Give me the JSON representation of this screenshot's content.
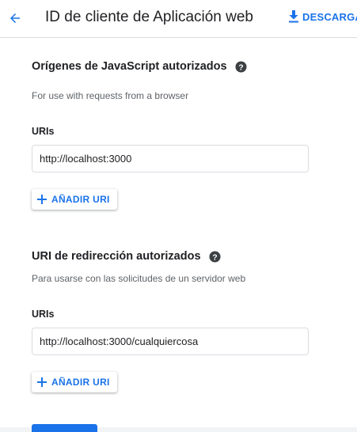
{
  "header": {
    "title": "ID de cliente de Aplicación web",
    "download_label": "DESCARGAR"
  },
  "js_origins": {
    "title": "Orígenes de JavaScript autorizados",
    "description": "For use with requests from a browser",
    "field_label": "URIs",
    "uri_value": "http://localhost:3000",
    "add_label": "AÑADIR URI"
  },
  "redirect_uris": {
    "title": "URI de redirección autorizados",
    "description": "Para usarse con las solicitudes de un servidor web",
    "field_label": "URIs",
    "uri_value": "http://localhost:3000/cualquiercosa",
    "add_label": "AÑADIR URI"
  },
  "icons": {
    "back": "arrow-back-icon",
    "download": "download-icon",
    "help": "help-icon",
    "add": "plus-icon"
  },
  "colors": {
    "accent": "#1a73e8",
    "text": "#202124",
    "muted": "#5f6368",
    "border": "#dadce0"
  }
}
